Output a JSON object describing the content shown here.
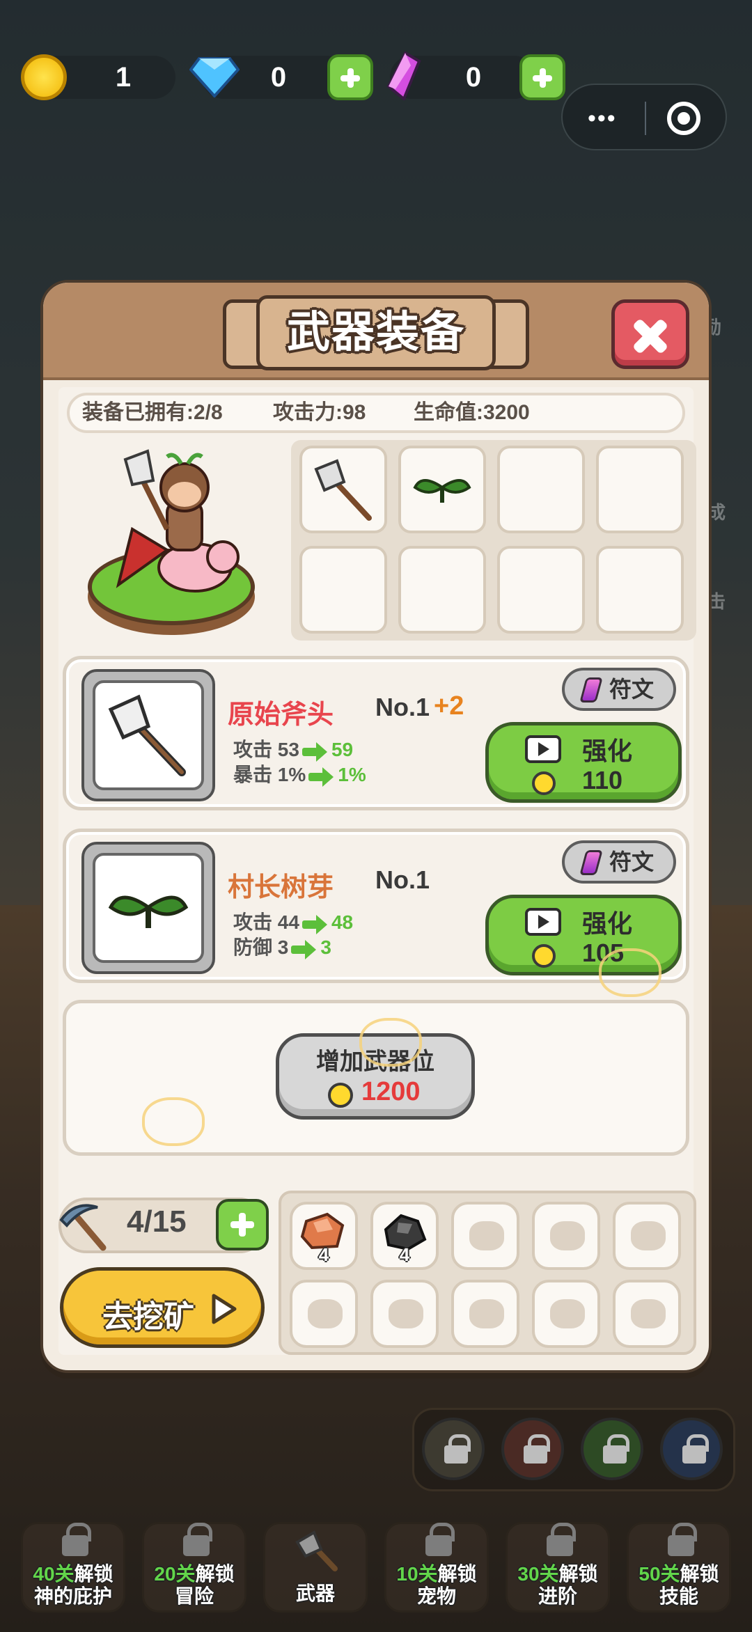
{
  "currency": {
    "coins": "1",
    "diamonds": "0",
    "crystals": "0"
  },
  "panel": {
    "title": "武器装备",
    "stats": {
      "owned": "装备已拥有:2/8",
      "attack": "攻击力:98",
      "hp": "生命值:3200"
    }
  },
  "weapons": [
    {
      "name": "原始斧头",
      "name_color": "#e8454d",
      "level": "No.1",
      "bonus": "+2",
      "stat1_label": "攻击 53",
      "stat1_new": "59",
      "stat2_label": "暴击 1%",
      "stat2_new": "1%",
      "rune_label": "符文",
      "upgrade_label": "强化",
      "upgrade_cost": "110",
      "icon": "axe-icon"
    },
    {
      "name": "村长树芽",
      "name_color": "#d9753a",
      "level": "No.1",
      "bonus": "",
      "stat1_label": "攻击 44",
      "stat1_new": "48",
      "stat2_label": "防御 3",
      "stat2_new": "3",
      "rune_label": "符文",
      "upgrade_label": "强化",
      "upgrade_cost": "105",
      "icon": "sprout-icon"
    }
  ],
  "add_slot": {
    "label": "增加武器位",
    "cost": "1200"
  },
  "mining": {
    "pickaxes": "4/15",
    "go_label": "去挖矿",
    "ores": [
      {
        "icon": "copper-ore-icon",
        "count": "4"
      },
      {
        "icon": "coal-ore-icon",
        "count": "4"
      }
    ]
  },
  "bottom_nav": [
    {
      "prefix": "40关",
      "suffix": "解锁",
      "line2": "神的庇护",
      "locked": true
    },
    {
      "prefix": "20关",
      "suffix": "解锁",
      "line2": "冒险",
      "locked": true
    },
    {
      "prefix": "",
      "suffix": "",
      "line2": "武器",
      "locked": false
    },
    {
      "prefix": "10关",
      "suffix": "解锁",
      "line2": "宠物",
      "locked": true
    },
    {
      "prefix": "30关",
      "suffix": "解锁",
      "line2": "进阶",
      "locked": true
    },
    {
      "prefix": "50关",
      "suffix": "解锁",
      "line2": "技能",
      "locked": true
    }
  ],
  "side_labels": {
    "right_1": "励",
    "right_2": "成",
    "right_3": "击"
  },
  "colors": {
    "green_button": "#7dcc44",
    "close_red": "#e45a63",
    "gold": "#f7c53a",
    "cost_red": "#e53b3b"
  }
}
